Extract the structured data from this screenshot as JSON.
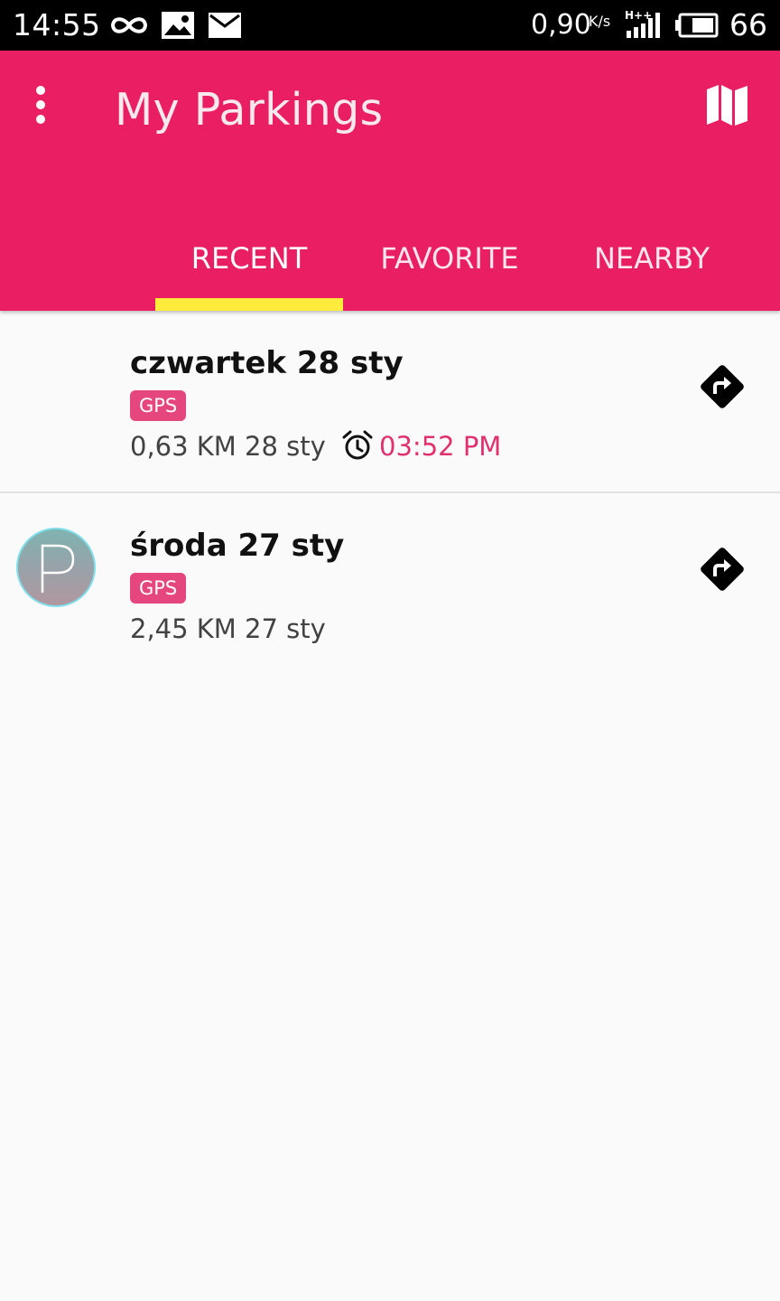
{
  "status_bar": {
    "time": "14:55",
    "net_speed": "0,90",
    "net_speed_unit": "K/s",
    "battery": "66",
    "icons": [
      "infinity-icon",
      "image-icon",
      "mail-icon",
      "signal-hplus-icon",
      "battery-icon"
    ]
  },
  "app_bar": {
    "title": "My Parkings",
    "menu_icon": "more-vert-icon",
    "map_icon": "map-icon",
    "color": "#e91e63"
  },
  "tabs": [
    {
      "label": "RECENT",
      "selected": true
    },
    {
      "label": "FAVORITE",
      "selected": false
    },
    {
      "label": "NEARBY",
      "selected": false
    }
  ],
  "tab_indicator_color": "#ffeb3b",
  "parkings": [
    {
      "title": "czwartek 28 sty",
      "badge": "GPS",
      "distance_date": "0,63 KM 28 sty",
      "alarm_icon": "alarm-icon",
      "alarm_time": "03:52 PM",
      "nav_icon": "directions-icon"
    },
    {
      "title": "środa 27 sty",
      "badge": "GPS",
      "distance_date": "2,45 KM 27 sty",
      "avatar_icon": "parking-p-icon",
      "nav_icon": "directions-icon"
    }
  ],
  "colors": {
    "accent": "#e91e63",
    "badge": "#e4467d",
    "alarm_time": "#e0306e",
    "background": "#fafafa"
  }
}
